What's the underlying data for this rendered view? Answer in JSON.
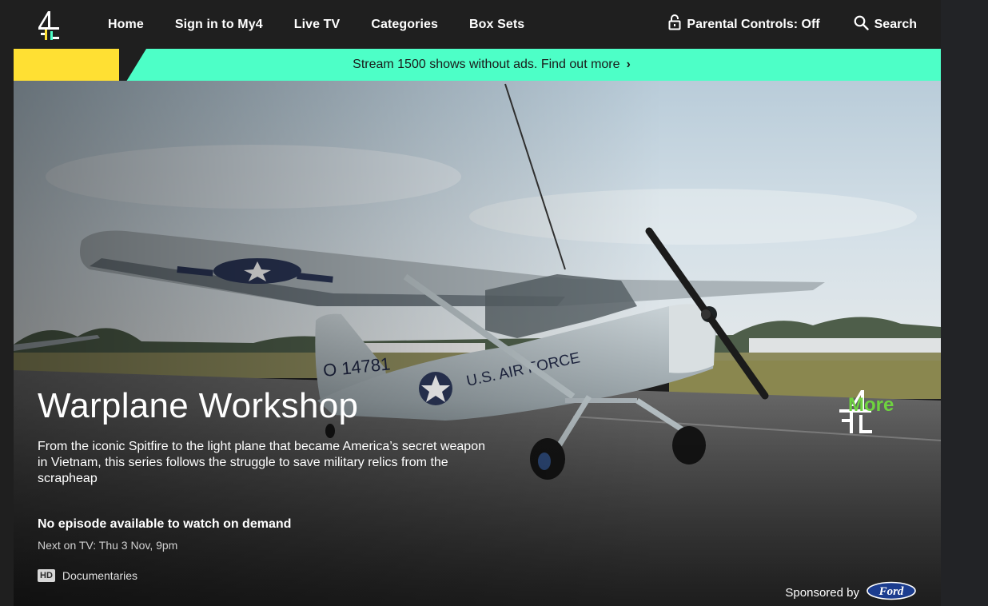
{
  "nav": {
    "logo_alt": "Channel 4",
    "links": [
      "Home",
      "Sign in to My4",
      "Live TV",
      "Categories",
      "Box Sets"
    ],
    "parental_controls": "Parental Controls: Off",
    "search": "Search"
  },
  "promo": {
    "text": "Stream 1500 shows without ads. Find out more",
    "chevron": "›",
    "colors": {
      "banner": "#4dffc7",
      "yellow": "#ffe033"
    }
  },
  "show": {
    "title": "Warplane Workshop",
    "description": "From the iconic Spitfire to the light plane that became America’s secret weapon in Vietnam, this series follows the struggle to save military relics from the scrapheap",
    "availability": "No episode available to watch on demand",
    "next_on_tv": "Next on TV: Thu 3 Nov, 9pm",
    "badge": "HD",
    "genre": "Documentaries",
    "channel_logo_text": "More",
    "sponsor_label": "Sponsored by",
    "sponsor_brand": "Ford"
  },
  "icons": {
    "logo": "channel4-logo-icon",
    "parental": "lock-icon",
    "search": "search-icon",
    "promo": "chevron-right-icon",
    "channel": "more4-logo-icon",
    "sponsor": "ford-logo-icon"
  }
}
